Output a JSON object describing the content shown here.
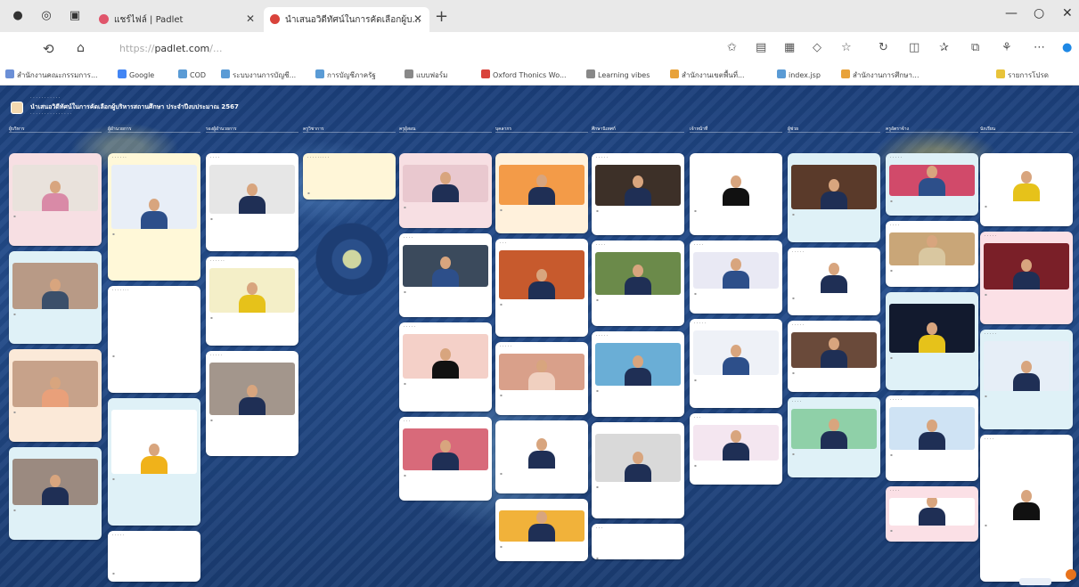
{
  "browser": {
    "tabs": [
      {
        "title": "แชร์ไฟล์ | Padlet",
        "active": false,
        "favicon_color": "#e0556b"
      },
      {
        "title": "นำเสนอวิดีทัศน์ในการคัดเลือกผู้บ...",
        "active": true,
        "favicon_color": "#d9433b"
      }
    ],
    "new_tab": "+",
    "url_host": "padlet.com",
    "url_prefix": "https://",
    "url_rest": "/...",
    "bookmarks": [
      {
        "label": "สำนักงานคณะกรรมการ...",
        "color": "#6b8fd6"
      },
      {
        "label": "Google",
        "color": "#4285f4"
      },
      {
        "label": "COD",
        "color": "#5a9bd5"
      },
      {
        "label": "ระบบงานการบัญชี...",
        "color": "#5a9bd5"
      },
      {
        "label": "การบัญชีภาครัฐ",
        "color": "#5a9bd5"
      },
      {
        "label": "แบบฟอร์ม",
        "color": "#888888"
      },
      {
        "label": "Oxford Thonics Wo...",
        "color": "#d9433b"
      },
      {
        "label": "Learning vibes",
        "color": "#888888"
      },
      {
        "label": "สำนักงานเขตพื้นที่...",
        "color": "#e8a23a"
      },
      {
        "label": "index.jsp",
        "color": "#5a9bd5"
      },
      {
        "label": "สำนักงานการศึกษา...",
        "color": "#e8a23a"
      },
      {
        "label": "รายการโปรด",
        "color": "#e8c33a"
      }
    ]
  },
  "board": {
    "crumb": "· · · · · · · · · · ·",
    "title": "นำเสนอวิดีทัศน์ในการคัดเลือกผู้บริหารสถานศึกษา ประจำปีงบประมาณ 2567",
    "subtitle": "· · · · · · · · · · · · · · ·",
    "columns": [
      {
        "head": "ผู้บริหาร",
        "posts": [
          {
            "h": 104,
            "bg": "#f7dfe3",
            "ph": "#e9e2dc",
            "suit": "#d98aa7",
            "title": ""
          },
          {
            "h": 104,
            "bg": "#dff1f7",
            "ph": "#b89a86",
            "suit": "#3b4f6a",
            "title": ""
          },
          {
            "h": 104,
            "bg": "#fbe9d8",
            "ph": "#c7a28a",
            "suit": "#e9a07a",
            "title": ""
          },
          {
            "h": 104,
            "bg": "#dff1f7",
            "ph": "#9b8a80",
            "suit": "#1f2f55",
            "title": ""
          }
        ]
      },
      {
        "head": "ผู้อำนวยการ",
        "posts": [
          {
            "h": 143,
            "bg": "#fff8d8",
            "ph": "#e8eef7",
            "suit": "#2d4f8a",
            "title": "· · · · · ·"
          },
          {
            "h": 120,
            "bg": "#ffffff",
            "ph": "#ffffff",
            "suit": "#ffffff",
            "title": "· · · · · · ·"
          },
          {
            "h": 143,
            "bg": "#dff1f7",
            "ph": "#ffffff",
            "suit": "#f0b21a",
            "title": ""
          },
          {
            "h": 60,
            "bg": "#ffffff",
            "ph": "#ffffff",
            "suit": "#ffffff",
            "title": "· · · · ·"
          }
        ]
      },
      {
        "head": "รองผู้อำนวยการ",
        "posts": [
          {
            "h": 110,
            "bg": "#ffffff",
            "ph": "#e6e6e6",
            "suit": "#1f2f55",
            "title": "· · · ·"
          },
          {
            "h": 100,
            "bg": "#ffffff",
            "ph": "#f4efc8",
            "suit": "#e6c21a",
            "title": "· · · · · ·"
          },
          {
            "h": 118,
            "bg": "#ffffff",
            "ph": "#a3968c",
            "suit": "#1f2f55",
            "title": "· · · · ·"
          }
        ]
      },
      {
        "head": "ครูวิชาการ",
        "posts": [
          {
            "h": 52,
            "bg": "#fff6d8",
            "ph": "#fff6d8",
            "suit": "#fff6d8",
            "title": "· · · · · · · · ·"
          }
        ]
      },
      {
        "head": "ครูผู้สอน",
        "posts": [
          {
            "h": 84,
            "bg": "#f7dfe3",
            "ph": "#e9c8cf",
            "suit": "#1f2f55",
            "title": ""
          },
          {
            "h": 94,
            "bg": "#ffffff",
            "ph": "#3b4a5c",
            "suit": "#2d4f8a",
            "title": "· · · ·"
          },
          {
            "h": 100,
            "bg": "#ffffff",
            "ph": "#f4d0c8",
            "suit": "#111111",
            "title": "· · · · ·"
          },
          {
            "h": 94,
            "bg": "#ffffff",
            "ph": "#d86a7a",
            "suit": "#1f2f55",
            "title": "· · ·"
          }
        ]
      },
      {
        "head": "บุคลากร",
        "posts": [
          {
            "h": 90,
            "bg": "#fff1dc",
            "ph": "#f39b48",
            "suit": "#1f2f55",
            "title": ""
          },
          {
            "h": 110,
            "bg": "#ffffff",
            "ph": "#c75a2d",
            "suit": "#1f2f55",
            "title": "· · ·"
          },
          {
            "h": 82,
            "bg": "#ffffff",
            "ph": "#d9a08a",
            "suit": "#f0d0c0",
            "title": "· · · · ·"
          },
          {
            "h": 82,
            "bg": "#ffffff",
            "ph": "#ffffff",
            "suit": "#1f2f55",
            "title": ""
          },
          {
            "h": 70,
            "bg": "#ffffff",
            "ph": "#f1b23a",
            "suit": "#1f2f55",
            "title": ""
          }
        ]
      },
      {
        "head": "ศึกษานิเทศก์",
        "posts": [
          {
            "h": 92,
            "bg": "#ffffff",
            "ph": "#3d3028",
            "suit": "#1f2f55",
            "title": "· · · · ·"
          },
          {
            "h": 96,
            "bg": "#ffffff",
            "ph": "#6b8a4a",
            "suit": "#1f2f55",
            "title": "· · · ·"
          },
          {
            "h": 96,
            "bg": "#ffffff",
            "ph": "#6aaed6",
            "suit": "#1f2f55",
            "title": "· · · · ·"
          },
          {
            "h": 108,
            "bg": "#ffffff",
            "ph": "#d9d9d9",
            "suit": "#1f2f55",
            "title": ""
          },
          {
            "h": 40,
            "bg": "#ffffff",
            "ph": "#ffffff",
            "suit": "#ffffff",
            "title": "· · ·"
          }
        ]
      },
      {
        "head": "เจ้าหน้าที่",
        "posts": [
          {
            "h": 92,
            "bg": "#ffffff",
            "ph": "#ffffff",
            "suit": "#111111",
            "title": ""
          },
          {
            "h": 82,
            "bg": "#ffffff",
            "ph": "#e9e9f4",
            "suit": "#2d4f8a",
            "title": "· · · ·"
          },
          {
            "h": 100,
            "bg": "#ffffff",
            "ph": "#eef1f7",
            "suit": "#2d4f8a",
            "title": "· · · · ·"
          },
          {
            "h": 80,
            "bg": "#ffffff",
            "ph": "#f4e6f0",
            "suit": "#1f2f55",
            "title": "· · ·"
          }
        ]
      },
      {
        "head": "ผู้ช่วย",
        "posts": [
          {
            "h": 100,
            "bg": "#dff1f7",
            "ph": "#5a3a2a",
            "suit": "#1f2f55",
            "title": ""
          },
          {
            "h": 76,
            "bg": "#ffffff",
            "ph": "#ffffff",
            "suit": "#1f2f55",
            "title": "· · · · ·"
          },
          {
            "h": 80,
            "bg": "#ffffff",
            "ph": "#6a4a3a",
            "suit": "#1f2f55",
            "title": "· · · · ·"
          },
          {
            "h": 90,
            "bg": "#dff1f7",
            "ph": "#8fd0a8",
            "suit": "#1f2f55",
            "title": "· · · ·"
          }
        ]
      },
      {
        "head": "ครูอัตราจ้าง",
        "posts": [
          {
            "h": 70,
            "bg": "#dff1f7",
            "ph": "#d14a6a",
            "suit": "#2d4f8a",
            "title": "· · · · ·"
          },
          {
            "h": 74,
            "bg": "#ffffff",
            "ph": "#c9a678",
            "suit": "#d9c7a0",
            "title": "· · · ·"
          },
          {
            "h": 110,
            "bg": "#dff1f7",
            "ph": "#121a2e",
            "suit": "#e6c21a",
            "title": ""
          },
          {
            "h": 96,
            "bg": "#ffffff",
            "ph": "#cfe3f4",
            "suit": "#1f2f55",
            "title": "· · · · ·"
          },
          {
            "h": 62,
            "bg": "#fbe0e6",
            "ph": "#ffffff",
            "suit": "#1f2f55",
            "title": "· · · ·"
          }
        ]
      },
      {
        "head": "นักเรียน",
        "posts": [
          {
            "h": 82,
            "bg": "#ffffff",
            "ph": "#ffffff",
            "suit": "#e6c21a",
            "title": ""
          },
          {
            "h": 104,
            "bg": "#fbe0e6",
            "ph": "#7a1f28",
            "suit": "#1f2f55",
            "title": "· · · · ·"
          },
          {
            "h": 112,
            "bg": "#dff1f7",
            "ph": "#e6eef7",
            "suit": "#1f2f55",
            "title": "· · · · ·"
          },
          {
            "h": 178,
            "bg": "#ffffff",
            "ph": "#ffffff",
            "suit": "#111111",
            "title": "· · · ·"
          }
        ]
      }
    ]
  }
}
